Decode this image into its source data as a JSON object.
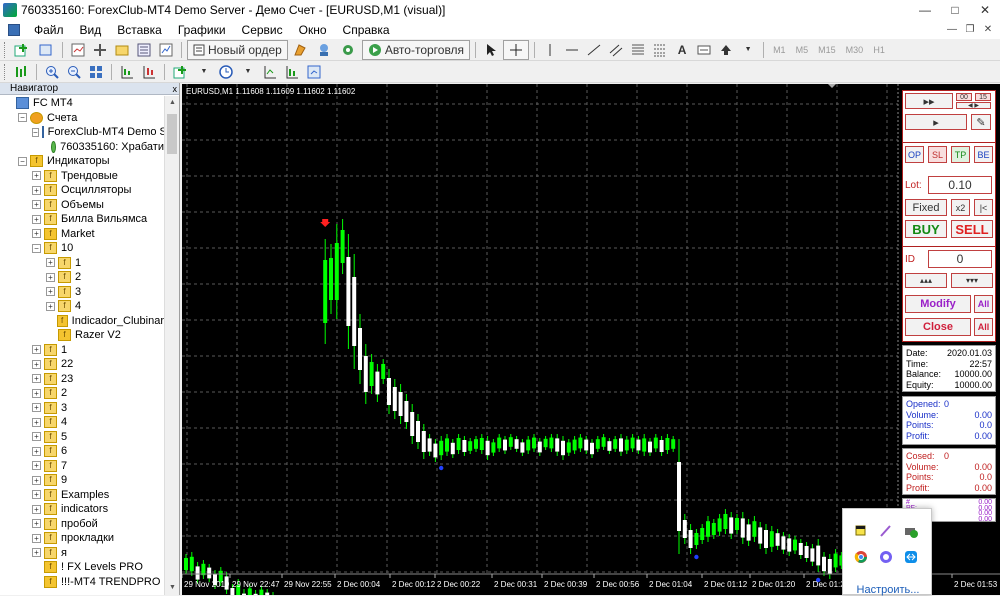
{
  "window": {
    "title": "760335160: ForexClub-MT4 Demo Server - Демо Счет - [EURUSD,M1 (visual)]",
    "controls": [
      "—",
      "□",
      "✕"
    ]
  },
  "menu": [
    "Файл",
    "Вид",
    "Вставка",
    "Графики",
    "Сервис",
    "Окно",
    "Справка"
  ],
  "toolbar": {
    "new_order": "Новый ордер",
    "auto_trading": "Авто-торговля",
    "timeframes": [
      "M1",
      "M5",
      "M15",
      "M30",
      "H1"
    ]
  },
  "navigator": {
    "title": "Навигатор",
    "close": "x",
    "tree": [
      {
        "label": "FC MT4",
        "level": 0,
        "exp": "",
        "icon": "terminal-icon"
      },
      {
        "label": "Счета",
        "level": 1,
        "exp": "−",
        "icon": "accounts-icon"
      },
      {
        "label": "ForexClub-MT4 Demo S",
        "level": 2,
        "exp": "−",
        "icon": "server-icon"
      },
      {
        "label": "760335160: Храбати",
        "level": 3,
        "exp": "",
        "icon": "user-icon"
      },
      {
        "label": "Индикаторы",
        "level": 1,
        "exp": "−",
        "icon": "indicators-icon"
      },
      {
        "label": "Трендовые",
        "level": 2,
        "exp": "+",
        "icon": "folder-icon"
      },
      {
        "label": "Осцилляторы",
        "level": 2,
        "exp": "+",
        "icon": "folder-icon"
      },
      {
        "label": "Объемы",
        "level": 2,
        "exp": "+",
        "icon": "folder-icon"
      },
      {
        "label": "Билла Вильямса",
        "level": 2,
        "exp": "+",
        "icon": "folder-icon"
      },
      {
        "label": "Market",
        "level": 2,
        "exp": "+",
        "icon": "market-icon"
      },
      {
        "label": "10",
        "level": 2,
        "exp": "−",
        "icon": "folder-icon"
      },
      {
        "label": "1",
        "level": 3,
        "exp": "+",
        "icon": "folder-icon"
      },
      {
        "label": "2",
        "level": 3,
        "exp": "+",
        "icon": "folder-icon"
      },
      {
        "label": "3",
        "level": 3,
        "exp": "+",
        "icon": "folder-icon"
      },
      {
        "label": "4",
        "level": 3,
        "exp": "+",
        "icon": "folder-icon"
      },
      {
        "label": "Indicador_Clubinar",
        "level": 3,
        "exp": "",
        "icon": "indicator-icon"
      },
      {
        "label": "Razer V2",
        "level": 3,
        "exp": "",
        "icon": "indicator-icon"
      },
      {
        "label": "1",
        "level": 2,
        "exp": "+",
        "icon": "folder-icon"
      },
      {
        "label": "22",
        "level": 2,
        "exp": "+",
        "icon": "folder-icon"
      },
      {
        "label": "23",
        "level": 2,
        "exp": "+",
        "icon": "folder-icon"
      },
      {
        "label": "2",
        "level": 2,
        "exp": "+",
        "icon": "folder-icon"
      },
      {
        "label": "3",
        "level": 2,
        "exp": "+",
        "icon": "folder-icon"
      },
      {
        "label": "4",
        "level": 2,
        "exp": "+",
        "icon": "folder-icon"
      },
      {
        "label": "5",
        "level": 2,
        "exp": "+",
        "icon": "folder-icon"
      },
      {
        "label": "6",
        "level": 2,
        "exp": "+",
        "icon": "folder-icon"
      },
      {
        "label": "7",
        "level": 2,
        "exp": "+",
        "icon": "folder-icon"
      },
      {
        "label": "9",
        "level": 2,
        "exp": "+",
        "icon": "folder-icon"
      },
      {
        "label": "Examples",
        "level": 2,
        "exp": "+",
        "icon": "folder-icon"
      },
      {
        "label": "indicators",
        "level": 2,
        "exp": "+",
        "icon": "folder-icon"
      },
      {
        "label": "пробой",
        "level": 2,
        "exp": "+",
        "icon": "folder-icon"
      },
      {
        "label": "прокладки",
        "level": 2,
        "exp": "+",
        "icon": "folder-icon"
      },
      {
        "label": "я",
        "level": 2,
        "exp": "+",
        "icon": "folder-icon"
      },
      {
        "label": "! FX Levels PRO",
        "level": 2,
        "exp": "",
        "icon": "indicator-icon"
      },
      {
        "label": "!!!-MT4 TRENDPRO",
        "level": 2,
        "exp": "",
        "icon": "indicator-icon"
      }
    ]
  },
  "chart": {
    "info": "EURUSD,M1  1.11608 1.11609 1.11602 1.11602",
    "time_labels": [
      "29 Nov 2019",
      "29 Nov 22:47",
      "29 Nov 22:55",
      "2 Dec 00:04",
      "2 Dec 00:12",
      "2 Dec 00:22",
      "2 Dec 00:31",
      "2 Dec 00:39",
      "2 Dec 00:56",
      "2 Dec 01:04",
      "2 Dec 01:12",
      "2 Dec 01:20",
      "2 Dec 01:29",
      "2 Dec 01:53"
    ],
    "bull_color": "#00ff00",
    "bear_color": "#ffffff",
    "grid_color": "#5a5a5a"
  },
  "chart_data": {
    "type": "candlestick",
    "title": "",
    "series": [
      {
        "values": [
          [
            0,
            470,
            490
          ],
          [
            1,
            468,
            492
          ],
          [
            2,
            478,
            500
          ],
          [
            3,
            476,
            495
          ],
          [
            4,
            480,
            498
          ],
          [
            5,
            486,
            505
          ],
          [
            6,
            483,
            502
          ],
          [
            7,
            488,
            510
          ],
          [
            8,
            500,
            520
          ],
          [
            9,
            495,
            525
          ],
          [
            10,
            505,
            528
          ],
          [
            11,
            500,
            522
          ],
          [
            12,
            506,
            525
          ],
          [
            13,
            502,
            520
          ],
          [
            14,
            505,
            523
          ],
          [
            15,
            508,
            530
          ],
          [
            16,
            512,
            532
          ],
          [
            17,
            515,
            535
          ],
          [
            18,
            518,
            536
          ],
          [
            19,
            520,
            540
          ],
          [
            20,
            518,
            530
          ],
          [
            21,
            512,
            528
          ],
          [
            22,
            515,
            535
          ],
          [
            23,
            518,
            538
          ],
          [
            24,
            155,
            260
          ],
          [
            25,
            160,
            230
          ],
          [
            26,
            140,
            235
          ],
          [
            27,
            135,
            190
          ],
          [
            28,
            150,
            265
          ],
          [
            29,
            170,
            285
          ],
          [
            30,
            230,
            300
          ],
          [
            31,
            260,
            320
          ],
          [
            32,
            270,
            310
          ],
          [
            33,
            280,
            318
          ],
          [
            34,
            275,
            300
          ],
          [
            35,
            285,
            330
          ],
          [
            36,
            295,
            335
          ],
          [
            37,
            300,
            340
          ],
          [
            38,
            310,
            345
          ],
          [
            39,
            320,
            360
          ],
          [
            40,
            330,
            365
          ],
          [
            41,
            340,
            375
          ],
          [
            42,
            350,
            372
          ],
          [
            43,
            355,
            378
          ],
          [
            44,
            352,
            376
          ],
          [
            45,
            350,
            372
          ],
          [
            46,
            355,
            374
          ],
          [
            47,
            350,
            370
          ],
          [
            48,
            352,
            372
          ],
          [
            49,
            354,
            370
          ],
          [
            50,
            352,
            368
          ],
          [
            51,
            350,
            370
          ],
          [
            52,
            352,
            376
          ],
          [
            53,
            355,
            372
          ],
          [
            54,
            350,
            368
          ],
          [
            55,
            352,
            370
          ],
          [
            56,
            350,
            366
          ],
          [
            57,
            352,
            368
          ],
          [
            58,
            355,
            372
          ],
          [
            59,
            352,
            370
          ],
          [
            60,
            350,
            368
          ],
          [
            61,
            354,
            372
          ],
          [
            62,
            352,
            366
          ],
          [
            63,
            350,
            368
          ],
          [
            64,
            350,
            372
          ],
          [
            65,
            352,
            376
          ],
          [
            66,
            355,
            372
          ],
          [
            67,
            352,
            370
          ],
          [
            68,
            350,
            368
          ],
          [
            69,
            352,
            370
          ],
          [
            70,
            355,
            374
          ],
          [
            71,
            352,
            368
          ],
          [
            72,
            350,
            366
          ],
          [
            73,
            354,
            370
          ],
          [
            74,
            352,
            368
          ],
          [
            75,
            350,
            372
          ],
          [
            76,
            352,
            370
          ],
          [
            77,
            350,
            368
          ],
          [
            78,
            352,
            370
          ],
          [
            79,
            350,
            372
          ],
          [
            80,
            354,
            372
          ],
          [
            81,
            350,
            368
          ],
          [
            82,
            352,
            372
          ],
          [
            83,
            350,
            370
          ],
          [
            84,
            352,
            368
          ],
          [
            85,
            355,
            470
          ],
          [
            86,
            430,
            460
          ],
          [
            87,
            440,
            470
          ],
          [
            88,
            445,
            465
          ],
          [
            89,
            440,
            460
          ],
          [
            90,
            432,
            458
          ],
          [
            91,
            435,
            455
          ],
          [
            92,
            430,
            452
          ],
          [
            93,
            425,
            450
          ],
          [
            94,
            428,
            455
          ],
          [
            95,
            430,
            450
          ],
          [
            96,
            428,
            460
          ],
          [
            97,
            435,
            462
          ],
          [
            98,
            432,
            458
          ],
          [
            99,
            438,
            465
          ],
          [
            100,
            440,
            470
          ],
          [
            101,
            442,
            468
          ],
          [
            102,
            445,
            466
          ],
          [
            103,
            448,
            470
          ],
          [
            104,
            450,
            472
          ],
          [
            105,
            452,
            470
          ],
          [
            106,
            455,
            475
          ],
          [
            107,
            458,
            478
          ],
          [
            108,
            460,
            482
          ],
          [
            109,
            455,
            488
          ],
          [
            110,
            468,
            492
          ],
          [
            111,
            470,
            495
          ],
          [
            112,
            465,
            488
          ],
          [
            113,
            468,
            485
          ],
          [
            114,
            462,
            490
          ],
          [
            115,
            470,
            495
          ],
          [
            116,
            480,
            500
          ],
          [
            117,
            485,
            505
          ],
          [
            118,
            488,
            508
          ],
          [
            119,
            490,
            505
          ],
          [
            120,
            492,
            508
          ],
          [
            121,
            488,
            502
          ],
          [
            122,
            490,
            500
          ]
        ]
      }
    ],
    "markers": [
      {
        "type": "sell-arrow",
        "x": 24
      },
      {
        "type": "dot",
        "x": 44
      },
      {
        "type": "dot",
        "x": 88
      },
      {
        "type": "dot",
        "x": 109
      }
    ]
  },
  "panel": {
    "ff_label": "▸▸",
    "counter": "00",
    "counter_speed": "15",
    "play_label": "▸",
    "pencil_label": "✎",
    "op_label": "OP",
    "sl_label": "SL",
    "tp_label": "TP",
    "be_label": "BE",
    "lot_label": "Lot:",
    "lot_value": "0.10",
    "fixed_label": "Fixed",
    "x2_label": "x2",
    "half_label": "|<",
    "buy_label": "BUY",
    "sell_label": "SELL",
    "id_label": "ID",
    "id_value": "0",
    "up_label": "▴▴▴",
    "down_label": "▾▾▾",
    "modify_label": "Modify",
    "all_label": "All",
    "close_label": "Close",
    "info": {
      "date_k": "Date:",
      "date_v": "2020.01.03",
      "time_k": "Time:",
      "time_v": "22:57",
      "balance_k": "Balance:",
      "balance_v": "10000.00",
      "equity_k": "Equity:",
      "equity_v": "10000.00"
    },
    "opened": {
      "opened_k": "Opened:",
      "opened_v": "0",
      "volume_k": "Volume:",
      "volume_v": "0.00",
      "points_k": "Points:",
      "points_v": "0.0",
      "profit_k": "Profit:",
      "profit_v": "0.00"
    },
    "closed": {
      "closed_k": "Cosed:",
      "closed_v": "0",
      "volume_k": "Volume:",
      "volume_v": "0.00",
      "points_k": "Points:",
      "points_v": "0.0",
      "profit_k": "Profit:",
      "profit_v": "0.00"
    },
    "extra": {
      "k1": "#",
      "k2": "PF:",
      "v1": "0.00",
      "v2": "0.00",
      "v3": "0.00",
      "v4": "0.00"
    }
  },
  "tray": {
    "link": "Настроить...",
    "icons": [
      "sticky-note-icon",
      "pen-icon",
      "printer-check-icon",
      "chrome-icon",
      "viber-icon",
      "teamviewer-icon"
    ]
  }
}
